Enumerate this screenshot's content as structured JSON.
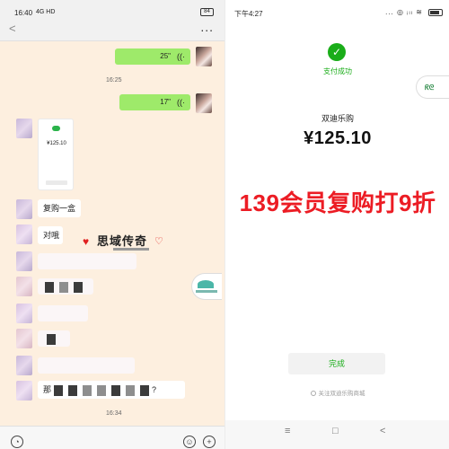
{
  "left": {
    "status": {
      "time": "16:40",
      "network": "4G HD",
      "battery": "84"
    },
    "nav": {
      "back": "<",
      "more": "..."
    },
    "messages": [
      {
        "duration": "25\""
      },
      {
        "duration": "17\""
      }
    ],
    "voice_glyph": "((·",
    "timestamps": [
      "16:25",
      "16:34"
    ],
    "receipt_thumb_amount": "¥125.10",
    "chat_texts": [
      "复购一盒",
      "对哦"
    ],
    "stamp_text": "思域传奇",
    "partial_text_start": "那",
    "partial_text_end": "?"
  },
  "right": {
    "status": {
      "time": "下午4:27",
      "icons": "... ◎ ᵢₗₗ ≋"
    },
    "pay_icon": "✓",
    "pay_title": "支付成功",
    "side_tab": "ᖇᘓ",
    "merchant": "双迪乐购",
    "amount": "¥125.10",
    "promo": "139会员复购打9折",
    "done": "完成",
    "follow": "关注双迪乐购商城",
    "nav": [
      "≡",
      "□",
      "<"
    ]
  }
}
